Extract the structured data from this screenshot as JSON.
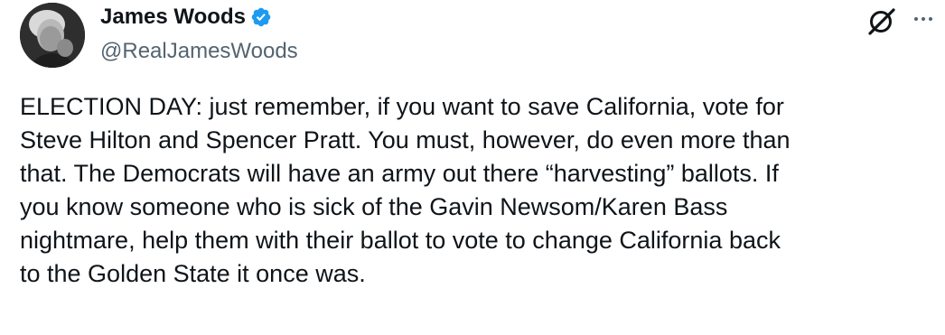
{
  "author": {
    "display_name": "James Woods",
    "handle": "@RealJamesWoods",
    "verified": true,
    "verified_badge_color": "#1d9bf0",
    "avatar_icon": "profile-photo"
  },
  "actions": {
    "grok_icon": "grok-icon",
    "more_icon": "more-options-icon"
  },
  "tweet": {
    "lines": [
      "ELECTION DAY: just remember, if you want to save California, vote for",
      "Steve Hilton and Spencer Pratt. You must, however, do even more than",
      "that. The Democrats will have an army out there “harvesting” ballots. If",
      "you know someone who is sick of the Gavin Newsom/Karen Bass",
      "nightmare, help them with their ballot to vote to change California back",
      "to the Golden State it once was."
    ]
  },
  "colors": {
    "text_primary": "#0f1419",
    "text_secondary": "#536471",
    "background": "#ffffff"
  }
}
